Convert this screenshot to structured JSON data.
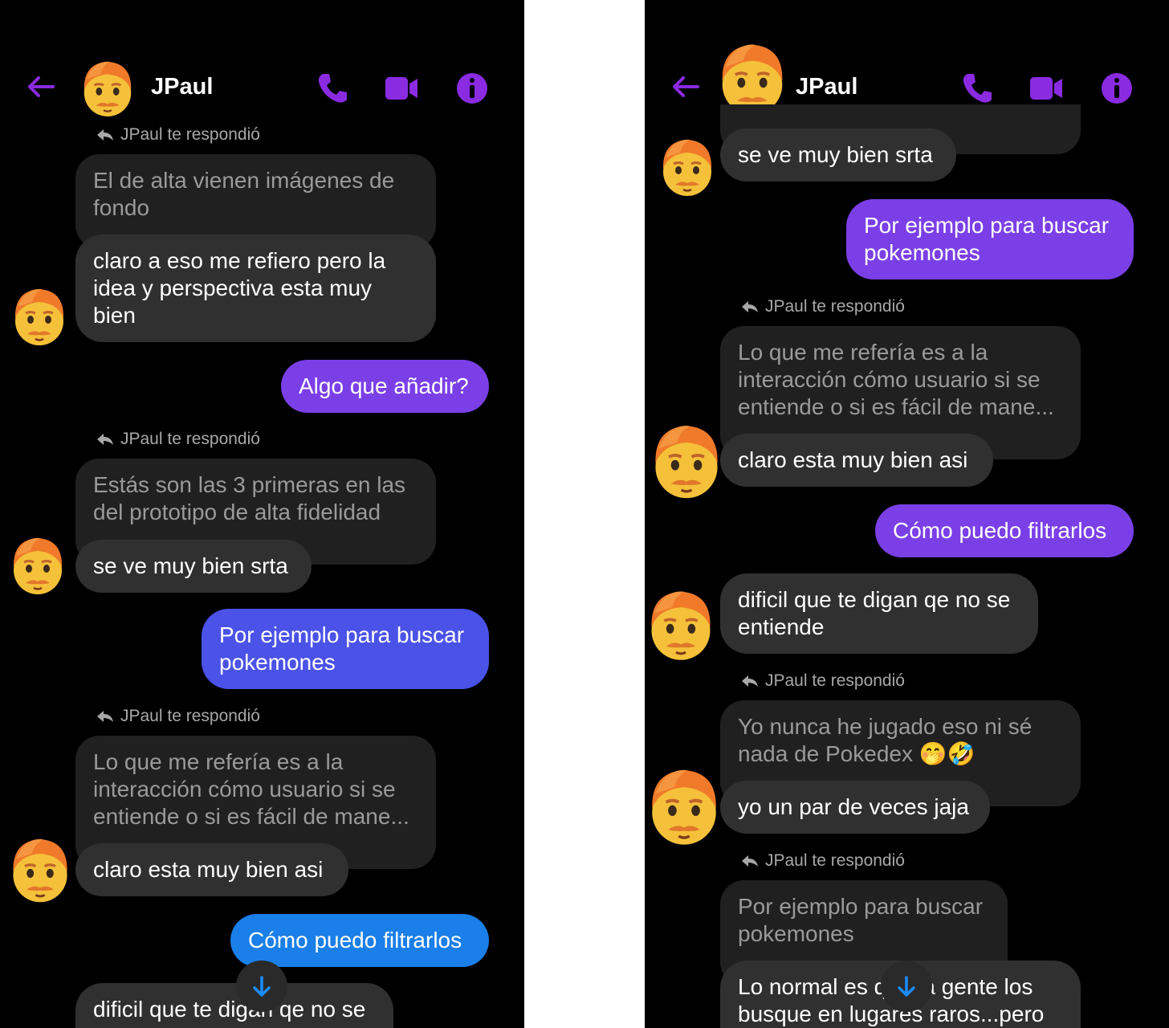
{
  "left": {
    "header": {
      "contact_name": "JPaul"
    },
    "messages": {
      "reply1": "JPaul te respondió",
      "q1": "El de alta vienen imágenes de fondo",
      "m1": "claro a eso me refiero pero la idea y perspectiva esta muy bien",
      "o1": "Algo que añadir?",
      "reply2": "JPaul te respondió",
      "q2": "Estás son las 3 primeras en las del prototipo de alta fidelidad",
      "m2": "se ve muy bien srta",
      "o2": "Por ejemplo para buscar pokemones",
      "reply3": "JPaul te respondió",
      "q3": "Lo que me refería es a la interacción cómo usuario si se entiende o si es fácil de mane...",
      "m3": "claro esta muy bien asi",
      "o3": "Cómo puedo filtrarlos",
      "m4": "dificil que te digan qe no se"
    }
  },
  "right": {
    "header": {
      "contact_name": "JPaul"
    },
    "messages": {
      "m1": "se ve muy bien srta",
      "o1": "Por ejemplo para buscar pokemones",
      "reply1": "JPaul te respondió",
      "q1": "Lo que me refería es a la interacción cómo usuario si se entiende o si es fácil de mane...",
      "m2": "claro esta muy bien asi",
      "o2": "Cómo puedo filtrarlos",
      "m3": "dificil que te digan qe no se entiende",
      "reply2": "JPaul te respondió",
      "q2": "Yo nunca he jugado eso ni sé nada de Pokedex 🤭🤣",
      "m4": "yo un par de veces jaja",
      "reply3": "JPaul te respondió",
      "q3": "Por ejemplo para buscar pokemones",
      "m5": "Lo normal es que la gente los busque en lugares raros...pero"
    }
  },
  "colors": {
    "accent": "#8a2be2",
    "out_violet": "#7b3fe8",
    "out_indigo": "#4a52e8",
    "out_blue": "#1a7fe8"
  },
  "icons": [
    "back-arrow-icon",
    "phone-icon",
    "video-camera-icon",
    "info-icon",
    "reply-arrow-icon",
    "arrow-down-icon",
    "avatar-emoji"
  ]
}
